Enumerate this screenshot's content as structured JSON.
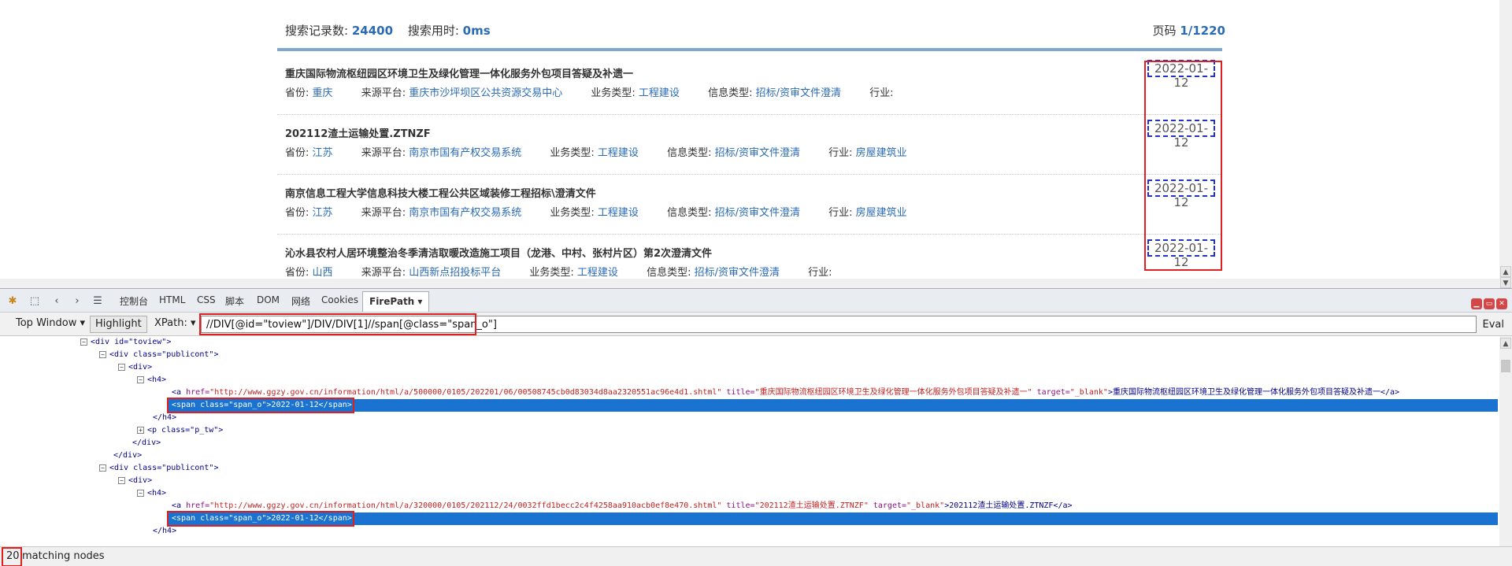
{
  "search_stats": {
    "records_label": "搜索记录数:",
    "records_value": "24400",
    "time_label": "搜索用时:",
    "time_value": "0ms",
    "page_label": "页码",
    "page_value": "1/1220"
  },
  "results": [
    {
      "title": "重庆国际物流枢纽园区环境卫生及绿化管理一体化服务外包项目答疑及补遗一",
      "date": "2022-01-12",
      "province_label": "省份:",
      "province": "重庆",
      "source_label": "来源平台:",
      "source": "重庆市沙坪坝区公共资源交易中心",
      "biz_label": "业务类型:",
      "biz": "工程建设",
      "info_label": "信息类型:",
      "info": "招标/资审文件澄清",
      "industry_label": "行业:",
      "industry": ""
    },
    {
      "title": "202112渣土运输处置.ZTNZF",
      "date": "2022-01-12",
      "province_label": "省份:",
      "province": "江苏",
      "source_label": "来源平台:",
      "source": "南京市国有产权交易系统",
      "biz_label": "业务类型:",
      "biz": "工程建设",
      "info_label": "信息类型:",
      "info": "招标/资审文件澄清",
      "industry_label": "行业:",
      "industry": "房屋建筑业"
    },
    {
      "title": "南京信息工程大学信息科技大楼工程公共区域装修工程招标\\澄清文件",
      "date": "2022-01-12",
      "province_label": "省份:",
      "province": "江苏",
      "source_label": "来源平台:",
      "source": "南京市国有产权交易系统",
      "biz_label": "业务类型:",
      "biz": "工程建设",
      "info_label": "信息类型:",
      "info": "招标/资审文件澄清",
      "industry_label": "行业:",
      "industry": "房屋建筑业"
    },
    {
      "title": "沁水县农村人居环境整治冬季清洁取暖改造施工项目（龙港、中村、张村片区）第2次澄清文件",
      "date": "2022-01-12",
      "province_label": "省份:",
      "province": "山西",
      "source_label": "来源平台:",
      "source": "山西新点招投标平台",
      "biz_label": "业务类型:",
      "biz": "工程建设",
      "info_label": "信息类型:",
      "info": "招标/资审文件澄清",
      "industry_label": "行业:",
      "industry": ""
    }
  ],
  "firebug_tabs": [
    "控制台",
    "HTML",
    "CSS",
    "脚本",
    "DOM",
    "网络",
    "Cookies",
    "FirePath"
  ],
  "firepath_bar": {
    "top_window": "Top Window",
    "highlight": "Highlight",
    "xpath_label": "XPath:",
    "xpath_value": "//DIV[@id=\"toview\"]/DIV/DIV[1]//span[@class=\"span_o\"]",
    "eval": "Eval"
  },
  "tree": {
    "div_toview": "<div id=\"toview\">",
    "div_publicont": "<div class=\"publicont\">",
    "div_open": "<div>",
    "h4_open": "<h4>",
    "a1_open": "<a ",
    "a1_href_attr": "href=",
    "a1_href_val": "\"http://www.ggzy.gov.cn/information/html/a/500000/0105/202201/06/00508745cb0d83034d8aa2320551ac96e4d1.shtml\"",
    "a1_title_attr": " title=",
    "a1_title_val": "\"重庆国际物流枢纽园区环境卫生及绿化管理一体化服务外包项目答疑及补遗一\"",
    "a1_target_attr": " target=",
    "a1_target_val": "\"_blank\"",
    "a1_text": ">重庆国际物流枢纽园区环境卫生及绿化管理一体化服务外包项目答疑及补遗一</a>",
    "span_line": "<span class=\"span_o\">2022-01-12</span>",
    "h4_close": "</h4>",
    "p_line": "<p class=\"p_tw\">",
    "div_close": "</div>",
    "a2_open": "<a ",
    "a2_href_attr": "href=",
    "a2_href_val": "\"http://www.ggzy.gov.cn/information/html/a/320000/0105/202112/24/0032ffd1becc2c4f4258aa910acb0ef8e470.shtml\"",
    "a2_title_attr": " title=",
    "a2_title_val": "\"202112渣土运输处置.ZTNZF\"",
    "a2_target_attr": " target=",
    "a2_target_val": "\"_blank\"",
    "a2_text": ">202112渣土运输处置.ZTNZF</a>"
  },
  "status": {
    "count": "20",
    "label": "matching nodes"
  },
  "colors": {
    "link_blue": "#2a6bb3",
    "highlight_red": "#e02020",
    "selection_blue": "#1a73d0"
  }
}
